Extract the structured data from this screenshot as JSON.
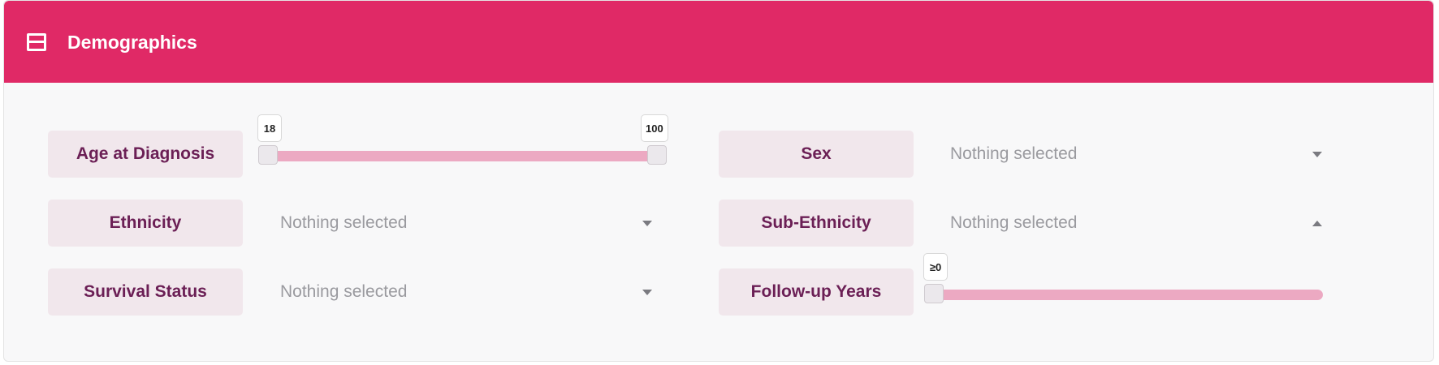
{
  "header": {
    "title": "Demographics",
    "icon": "panel-collapse-icon",
    "color": "#e02966"
  },
  "filters": {
    "age_at_diagnosis": {
      "label": "Age at Diagnosis",
      "min_label": "18",
      "max_label": "100",
      "min": 18,
      "max": 100
    },
    "sex": {
      "label": "Sex",
      "placeholder": "Nothing selected"
    },
    "ethnicity": {
      "label": "Ethnicity",
      "placeholder": "Nothing selected"
    },
    "sub_ethnicity": {
      "label": "Sub-Ethnicity",
      "placeholder": "Nothing selected"
    },
    "survival_status": {
      "label": "Survival Status",
      "placeholder": "Nothing selected"
    },
    "follow_up_years": {
      "label": "Follow-up Years",
      "value_label": "≥0"
    }
  }
}
